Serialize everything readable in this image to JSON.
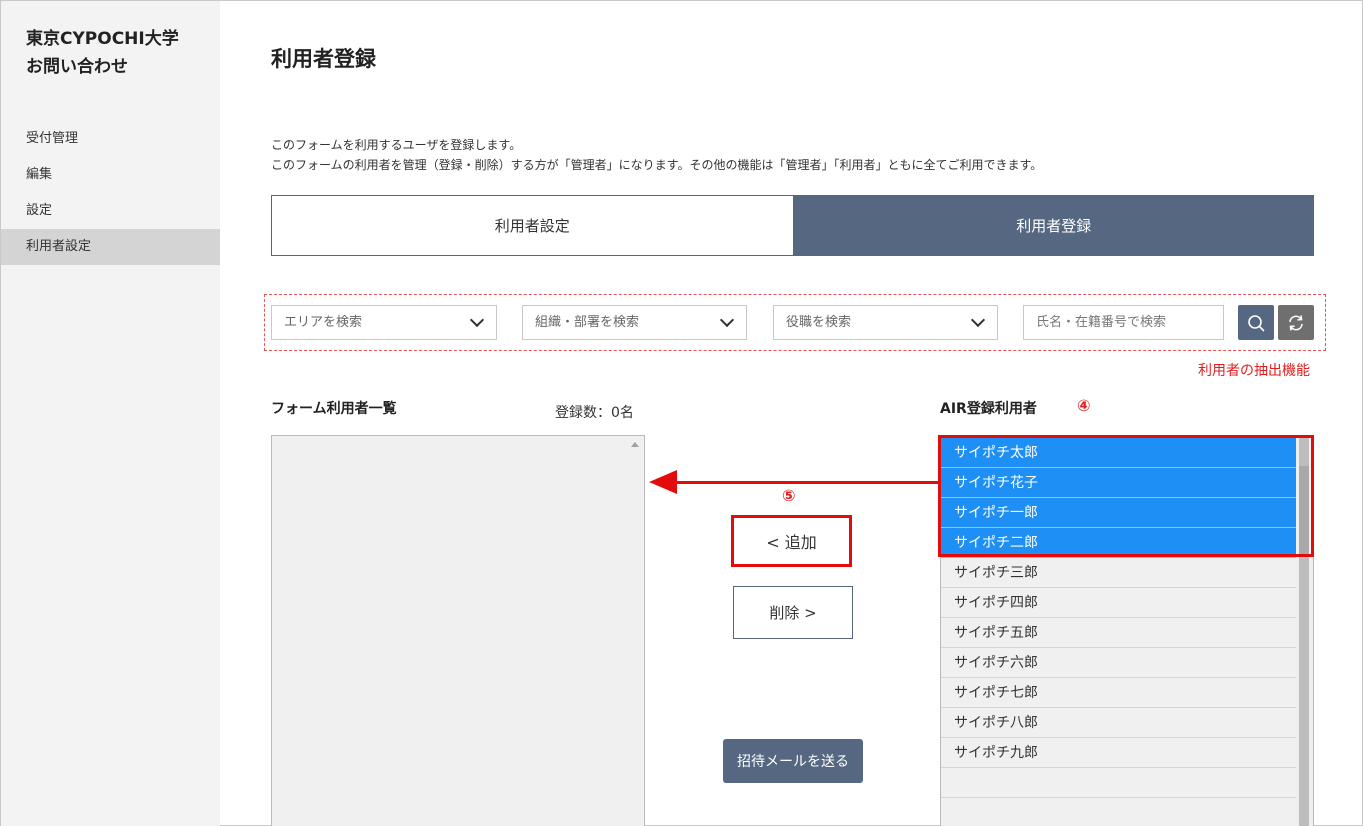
{
  "sidebar": {
    "brand_line1": "東京CYPOCHI大学",
    "brand_line2": "お問い合わせ",
    "items": [
      {
        "label": "受付管理"
      },
      {
        "label": "編集"
      },
      {
        "label": "設定"
      },
      {
        "label": "利用者設定"
      }
    ]
  },
  "main": {
    "title": "利用者登録",
    "desc_line1": "このフォームを利用するユーザを登録します。",
    "desc_line2": "このフォームの利用者を管理（登録・削除）する方が「管理者」になります。その他の機能は「管理者」「利用者」ともに全てご利用できます。",
    "tabs": [
      {
        "label": "利用者設定"
      },
      {
        "label": "利用者登録"
      }
    ],
    "filters": {
      "area_placeholder": "エリアを検索",
      "org_placeholder": "組織・部署を検索",
      "role_placeholder": "役職を検索",
      "name_placeholder": "氏名・在籍番号で検索"
    },
    "filter_caption": "利用者の抽出機能",
    "form_list_title": "フォーム利用者一覧",
    "count_label": "登録数：0名",
    "air_list_title": "AIR登録利用者",
    "marker_4": "④",
    "marker_5": "⑤",
    "add_button": "< 追加",
    "remove_button": "削除 >",
    "invite_button": "招待メールを送る",
    "air_users": [
      {
        "name": "サイポチ太郎"
      },
      {
        "name": "サイポチ花子"
      },
      {
        "name": "サイポチ一郎"
      },
      {
        "name": "サイポチ二郎"
      },
      {
        "name": "サイポチ三郎"
      },
      {
        "name": "サイポチ四郎"
      },
      {
        "name": "サイポチ五郎"
      },
      {
        "name": "サイポチ六郎"
      },
      {
        "name": "サイポチ七郎"
      },
      {
        "name": "サイポチ八郎"
      },
      {
        "name": "サイポチ九郎"
      }
    ]
  },
  "colors": {
    "accent": "#556781",
    "selection": "#1e8ff5",
    "annotation": "#e20c0c"
  }
}
